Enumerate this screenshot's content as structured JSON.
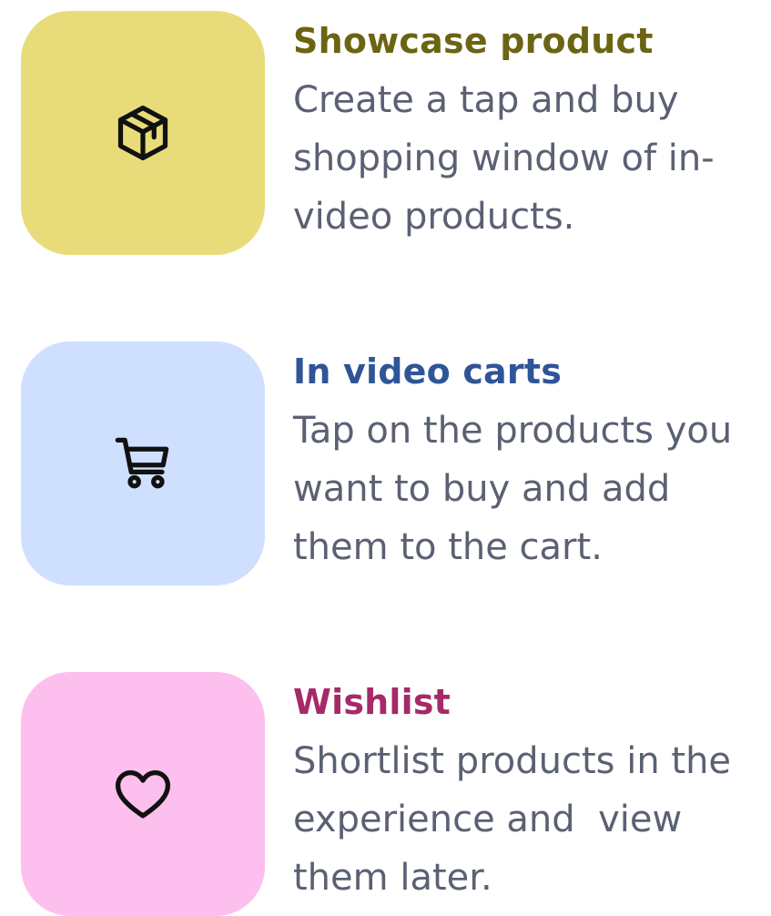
{
  "colors": {
    "description_text": "#5b6173",
    "icon_stroke": "#111111"
  },
  "features": [
    {
      "title": "Showcase product",
      "description": "Create a tap and buy shopping window of in-video products.",
      "icon": "package-box-icon",
      "tile_color": "#e8dc7a",
      "title_color": "#6b6412"
    },
    {
      "title": "In video carts",
      "description": "Tap on the products you want to buy and add them to the cart.",
      "icon": "shopping-cart-icon",
      "tile_color": "#cfe0ff",
      "title_color": "#2f5597"
    },
    {
      "title": "Wishlist",
      "description": "Shortlist products in the experience and  view them later.",
      "icon": "heart-icon",
      "tile_color": "#fdbfee",
      "title_color": "#a52a67"
    }
  ]
}
